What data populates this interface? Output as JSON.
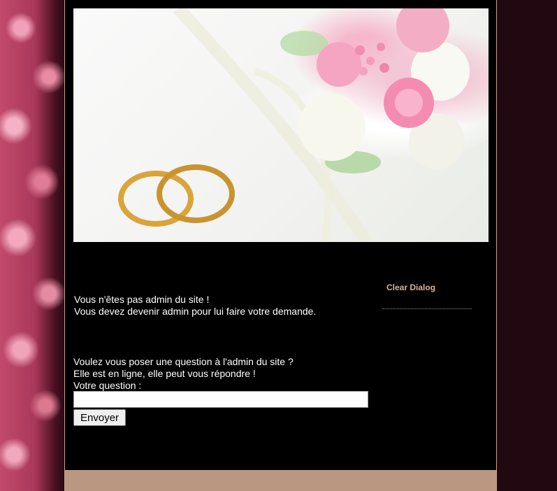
{
  "admin_notice": {
    "line1": "Vous n'êtes pas admin du site !",
    "line2": "Vous devez devenir admin pour lui faire votre demande."
  },
  "question_form": {
    "line1": "Voulez vous poser une question à l'admin du site ?",
    "line2": "Elle est en ligne, elle peut vous répondre !",
    "label": "Votre question :",
    "input_value": "",
    "submit_label": "Envoyer"
  },
  "sidebar": {
    "title": "Clear Dialog"
  },
  "colors": {
    "page_background": "#2a0a14",
    "content_background": "#000000",
    "accent": "#b99780",
    "sidebar_title": "#d6b49c"
  }
}
